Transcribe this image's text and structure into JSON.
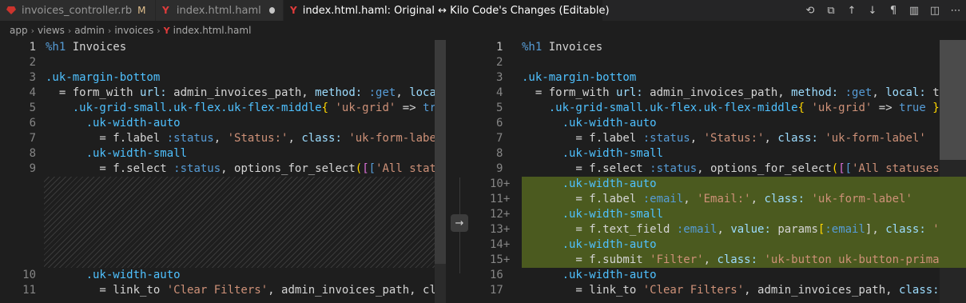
{
  "tabs": [
    {
      "label": "invoices_controller.rb",
      "badge": "M",
      "icon": "ruby-icon"
    },
    {
      "label": "index.html.haml",
      "icon": "haml-icon",
      "dirty": true
    },
    {
      "label": "index.html.haml: Original ↔ Kilo Code's Changes (Editable)",
      "icon": "haml-icon",
      "dirty": true,
      "active": true
    }
  ],
  "actions": [
    {
      "name": "history-icon",
      "glyph": "⟲"
    },
    {
      "name": "open-file-icon",
      "glyph": "⧉"
    },
    {
      "name": "arrow-up-icon",
      "glyph": "↑"
    },
    {
      "name": "arrow-down-icon",
      "glyph": "↓"
    },
    {
      "name": "pilcrow-icon",
      "glyph": "¶"
    },
    {
      "name": "map-icon",
      "glyph": "▥"
    },
    {
      "name": "split-editor-icon",
      "glyph": "◫"
    },
    {
      "name": "more-icon",
      "glyph": "⋯"
    }
  ],
  "breadcrumb": [
    "app",
    "views",
    "admin",
    "invoices",
    "index.html.haml"
  ],
  "colors": {
    "added_background": "#4b5a1f"
  },
  "revert_glyph": "→",
  "left": [
    {
      "n": "1",
      "code": "%h1 Invoices"
    },
    {
      "n": "2",
      "code": ""
    },
    {
      "n": "3",
      "code": ".uk-margin-bottom"
    },
    {
      "n": "4",
      "code": "  = form_with url: admin_invoices_path, method: :get, local:"
    },
    {
      "n": "5",
      "code": "    .uk-grid-small.uk-flex.uk-flex-middle{ 'uk-grid' => true"
    },
    {
      "n": "6",
      "code": "      .uk-width-auto"
    },
    {
      "n": "7",
      "code": "        = f.label :status, 'Status:', class: 'uk-form-label'"
    },
    {
      "n": "8",
      "code": "      .uk-width-small"
    },
    {
      "n": "9",
      "code": "        = f.select :status, options_for_select([['All status"
    },
    {
      "n": "10",
      "code": "      .uk-width-auto"
    },
    {
      "n": "11",
      "code": "        = link_to 'Clear Filters', admin_invoices_path, clas"
    }
  ],
  "right": [
    {
      "n": "1",
      "code": "%h1 Invoices"
    },
    {
      "n": "2",
      "code": ""
    },
    {
      "n": "3",
      "code": ".uk-margin-bottom"
    },
    {
      "n": "4",
      "code": "  = form_with url: admin_invoices_path, method: :get, local: tru"
    },
    {
      "n": "5",
      "code": "    .uk-grid-small.uk-flex.uk-flex-middle{ 'uk-grid' => true }"
    },
    {
      "n": "6",
      "code": "      .uk-width-auto"
    },
    {
      "n": "7",
      "code": "        = f.label :status, 'Status:', class: 'uk-form-label'"
    },
    {
      "n": "8",
      "code": "      .uk-width-small"
    },
    {
      "n": "9",
      "code": "        = f.select :status, options_for_select([['All statuses',"
    },
    {
      "n": "10+",
      "code": "      .uk-width-auto"
    },
    {
      "n": "11+",
      "code": "        = f.label :email, 'Email:', class: 'uk-form-label'"
    },
    {
      "n": "12+",
      "code": "      .uk-width-small"
    },
    {
      "n": "13+",
      "code": "        = f.text_field :email, value: params[:email], class: 'uk"
    },
    {
      "n": "14+",
      "code": "      .uk-width-auto"
    },
    {
      "n": "15+",
      "code": "        = f.submit 'Filter', class: 'uk-button uk-button-primary"
    },
    {
      "n": "16",
      "code": "      .uk-width-auto"
    },
    {
      "n": "17",
      "code": "        = link_to 'Clear Filters', admin_invoices_path, class: '"
    }
  ]
}
